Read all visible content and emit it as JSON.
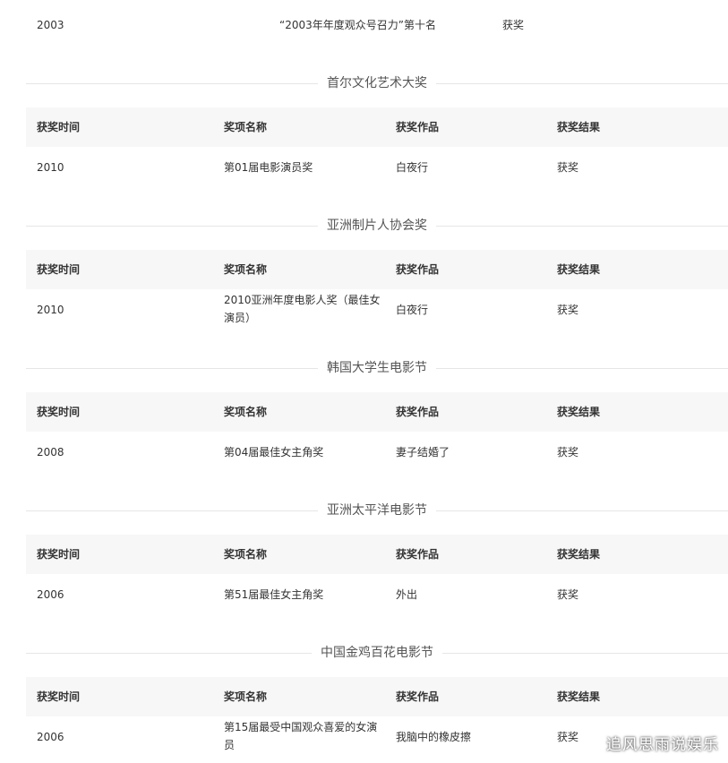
{
  "top_row": {
    "year": "2003",
    "award": "“2003年年度观众号召力”第十名",
    "result": "获奖"
  },
  "headers": {
    "time": "获奖时间",
    "name": "奖项名称",
    "work": "获奖作品",
    "result": "获奖结果"
  },
  "sections": [
    {
      "title": "首尔文化艺术大奖",
      "row": {
        "time": "2010",
        "name": "第01届电影演员奖",
        "work": "白夜行",
        "result": "获奖"
      }
    },
    {
      "title": "亚洲制片人协会奖",
      "row": {
        "time": "2010",
        "name": "2010亚洲年度电影人奖（最佳女演员）",
        "work": "白夜行",
        "result": "获奖"
      }
    },
    {
      "title": "韩国大学生电影节",
      "row": {
        "time": "2008",
        "name": "第04届最佳女主角奖",
        "work": "妻子结婚了",
        "result": "获奖"
      }
    },
    {
      "title": "亚洲太平洋电影节",
      "row": {
        "time": "2006",
        "name": "第51届最佳女主角奖",
        "work": "外出",
        "result": "获奖"
      }
    },
    {
      "title": "中国金鸡百花电影节",
      "row": {
        "time": "2006",
        "name": "第15届最受中国观众喜爱的女演员",
        "work": "我脑中的橡皮擦",
        "result": "获奖"
      }
    }
  ],
  "watermark": "追风思雨说娱乐",
  "colors": {
    "link": "#136ec2",
    "header_bg": "#f7f7f7",
    "rule": "#e6e6e6"
  }
}
